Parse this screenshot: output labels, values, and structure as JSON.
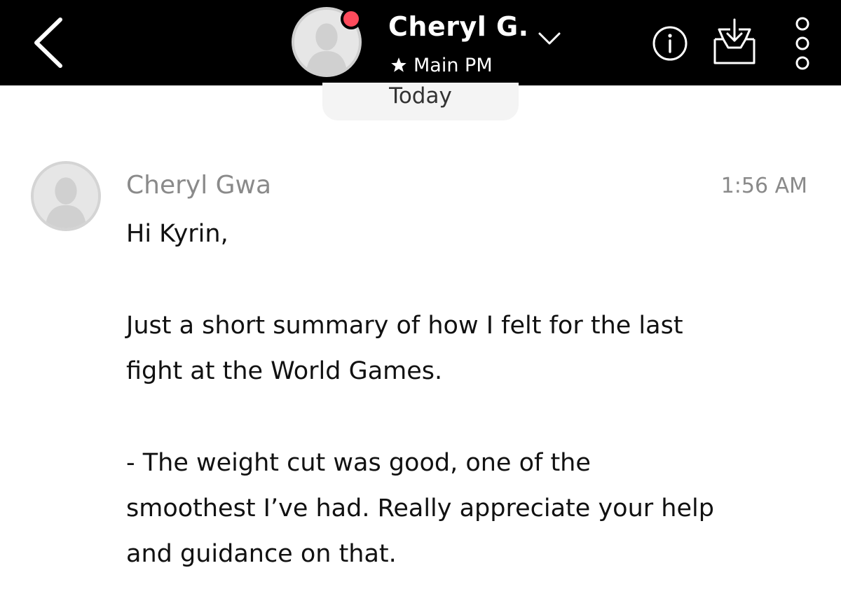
{
  "header": {
    "contact_name": "Cheryl G.",
    "subtitle": "Main PM",
    "presence_color": "#ff4b5c",
    "icons": {
      "back": "chevron-left-icon",
      "dropdown": "chevron-down-icon",
      "subtitle": "star-icon",
      "info": "info-icon",
      "inbox": "inbox-download-icon",
      "more": "more-vertical-icon"
    }
  },
  "date_separator": "Today",
  "message": {
    "sender": "Cheryl Gwa",
    "time": "1:56 AM",
    "lines": [
      "Hi Kyrin,",
      "Just a short summary of how I felt for the last",
      "fight at the World Games.",
      "- The weight cut was good, one of the",
      "smoothest I’ve had. Really appreciate your help",
      "and guidance on that."
    ]
  }
}
